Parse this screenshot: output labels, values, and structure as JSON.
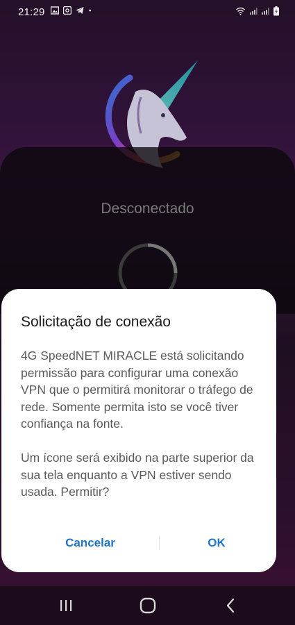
{
  "status_bar": {
    "time": "21:29",
    "left_icons": [
      "image-icon",
      "cast-icon",
      "telegram-icon",
      "dot-icon"
    ],
    "right_icons": [
      "wifi-icon",
      "signal-icon",
      "signal-icon-2",
      "battery-icon"
    ]
  },
  "app": {
    "connection_status": "Desconectado"
  },
  "dialog": {
    "title": "Solicitação de conexão",
    "body_paragraph_1": "4G SpeedNET MIRACLE está solicitando permissão para configurar uma conexão VPN que o permitirá monitorar o tráfego de rede. Somente permita isto se você tiver confiança na fonte.",
    "body_paragraph_2": "Um ícone será exibido na parte superior da sua tela enquanto a VPN estiver sendo usada. Permitir?",
    "cancel_label": "Cancelar",
    "ok_label": "OK"
  },
  "nav_bar": {
    "icons": [
      "recent-apps-icon",
      "home-icon",
      "back-icon"
    ]
  },
  "colors": {
    "accent": "#1e74c8",
    "dialog_bg": "#ffffff",
    "nav_bg": "#1c0b1b"
  }
}
